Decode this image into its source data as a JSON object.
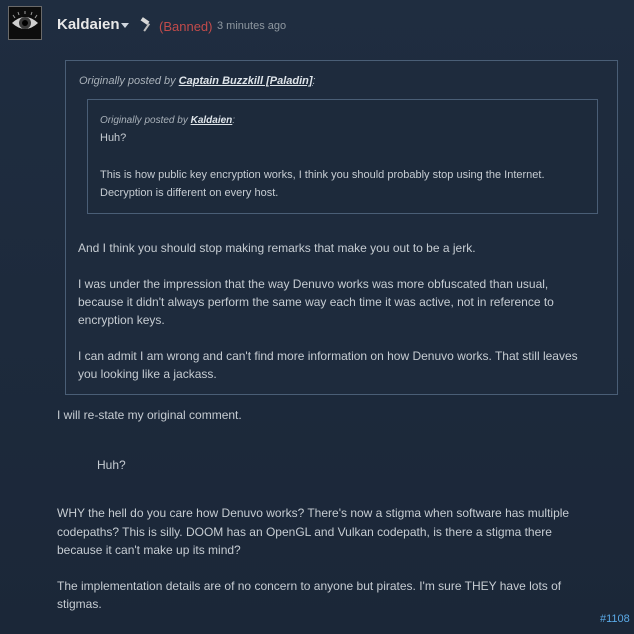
{
  "header": {
    "author": "Kaldaien",
    "status": "(Banned)",
    "timestamp": "3 minutes ago"
  },
  "quote": {
    "prefix": "Originally posted by",
    "author": "Captain Buzzkill [Paladin]",
    "inner": {
      "prefix": "Originally posted by",
      "author": "Kaldaien",
      "line1": "Huh?",
      "line2": "This is how public key encryption works, I think you should probably stop using the Internet.",
      "line3": "Decryption is different on every host."
    },
    "para1": "And I think you should stop making remarks that make you out to be a jerk.",
    "para2_l1": "I was under the impression that the way Denuvo works was more obfuscated than usual,",
    "para2_l2": "because it didn't always perform the same way each time it was active, not in reference to",
    "para2_l3": "encryption keys.",
    "para3_l1": "I can admit I am wrong and can't find more information on how Denuvo works. That still leaves",
    "para3_l2": "you looking like a jackass."
  },
  "reply": {
    "line1": "I will re-state my original comment.",
    "huh": "Huh?",
    "p1_l1": "WHY the hell do you care how Denuvo works? There's now a stigma when software has multiple",
    "p1_l2": "codepaths? This is silly. DOOM has an OpenGL and Vulkan codepath, is there a stigma there",
    "p1_l3": "because it can't make up its mind?",
    "p2_l1": "The implementation details are of no concern to anyone but pirates. I'm sure THEY have lots of",
    "p2_l2": "stigmas."
  },
  "post_id": "#1108",
  "icons": {
    "avatar": "eye-icon",
    "dropdown": "chevron-down-icon",
    "banned": "hammer-icon"
  },
  "colors": {
    "banned": "#c24b4b",
    "link": "#5aa9e6",
    "background": "#1d2a3c"
  }
}
